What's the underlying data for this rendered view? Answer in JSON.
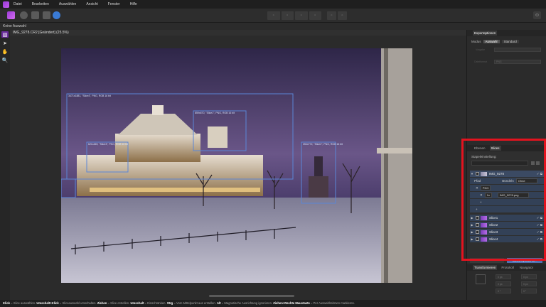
{
  "menu": [
    "Datei",
    "Bearbeiten",
    "Auswählen",
    "Ansicht",
    "Fenster",
    "Hilfe"
  ],
  "toolbar": {
    "user_icon": "user-icon"
  },
  "context": {
    "selection_label": "Keine Auswahl"
  },
  "document": {
    "tab_title": "IMG_9278.CR2 [Geändert] (25.5%)"
  },
  "slices_on_canvas": [
    {
      "label": "3471x1881, \"Slice4\", PNG, RGB 16 bit"
    },
    {
      "label": "859x670, \"Slice1\", PNG, RGB 16 bit"
    },
    {
      "label": "621x469, \"Slice3\", PNG, RGB 16 bit"
    },
    {
      "label": "354x772, \"Slice2\", PNG, RGB 16 bit"
    }
  ],
  "export_options": {
    "tabs": [
      "Exportoptionen"
    ],
    "mode_label": "Modus",
    "mode_options": [
      "Auswahl",
      "Standard"
    ],
    "field_labels": [
      "Vorgabe",
      "Dateiformat"
    ],
    "format_value": "PNG"
  },
  "slices_panel": {
    "tabs": [
      "Ebenen",
      "Slices"
    ],
    "preset_label": "Stapeleinstellung:",
    "main_slice": {
      "name": "IMG_9278"
    },
    "path_label": "Pfad",
    "format_label": "PNG",
    "scale_label": "1x",
    "buildin_label": "Bündeln",
    "buildin_value": "Ohne",
    "filename": "IMG_9278.png",
    "slices": [
      "Slice1",
      "Slice2",
      "Slice3",
      "Slice4"
    ],
    "export_button": "Slices exportieren..."
  },
  "transform_panel": {
    "tabs": [
      "Transformieren",
      "Protokoll",
      "Navigator"
    ],
    "fields": [
      "0 px",
      "0 px",
      "0 px",
      "0 px",
      "0 °",
      "0 °"
    ]
  },
  "status": {
    "parts": [
      {
        "b": "Klick",
        "t": " = Slice auswählen. "
      },
      {
        "b": "Umschalt+Klick",
        "t": " = Sliceauswahl umschalten. "
      },
      {
        "b": "Ziehen",
        "t": " = Slice erstellen. "
      },
      {
        "b": "Umschalt",
        "t": " = Einschränken. "
      },
      {
        "b": "Strg",
        "t": " = Vom Mittelpunkt aus erstellen. "
      },
      {
        "b": "Alt",
        "t": " = Magnetische Ausrichtung ignorieren. "
      },
      {
        "b": "Ziehen+Rechte Maustaste",
        "t": " = Per Auswahlrahmen markieren."
      }
    ]
  }
}
